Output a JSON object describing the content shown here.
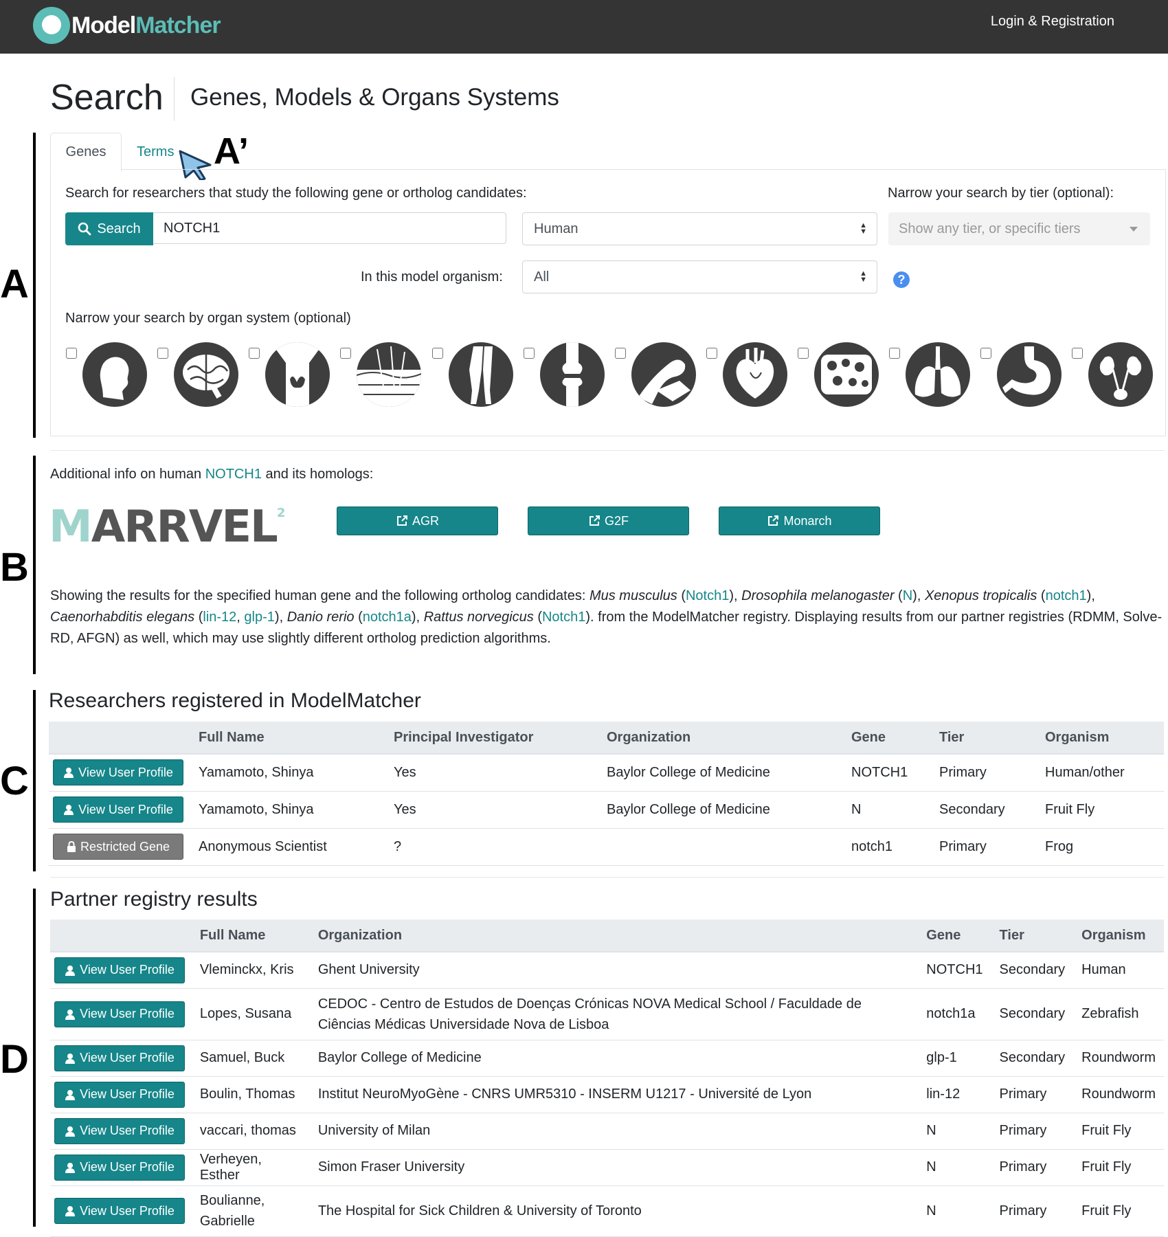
{
  "navbar": {
    "logo_a": "Model",
    "logo_b": "Matcher",
    "login": "Login & Registration"
  },
  "header": {
    "title": "Search",
    "subtitle": "Genes, Models & Organs Systems"
  },
  "section_labels": {
    "a": "A",
    "a_prime": "A’",
    "b": "B",
    "c": "C",
    "d": "D"
  },
  "tabs": {
    "genes": "Genes",
    "terms": "Terms"
  },
  "search": {
    "prompt": "Search for researchers that study the following gene or ortholog candidates:",
    "tier_prompt": "Narrow your search by tier (optional):",
    "button": "Search",
    "gene_value": "NOTCH1",
    "species_value": "Human",
    "tier_placeholder": "Show any tier, or specific tiers",
    "organism_label": "In this model organism:",
    "organism_value": "All",
    "help": "?",
    "organ_prompt": "Narrow your search by organ system (optional)"
  },
  "organs": [
    "head-neck",
    "brain",
    "thyroid",
    "skin",
    "limbs",
    "joint",
    "muscle",
    "heart",
    "blood",
    "lungs",
    "stomach",
    "kidney"
  ],
  "info": {
    "prefix": "Additional info on human ",
    "gene": "NOTCH1",
    "suffix": " and its homologs:"
  },
  "marrvel": {
    "m": "M",
    "rest": "ARRVEL",
    "sup": "2"
  },
  "external_links": [
    "AGR",
    "G2F",
    "Monarch"
  ],
  "results_text": {
    "p1": "Showing the results for the specified human gene and the following ortholog candidates: ",
    "sp1": "Mus musculus",
    "g1": "Notch1",
    "sp2": "Drosophila melanogaster",
    "g2": "N",
    "sp3": "Xenopus tropicalis",
    "g3": "notch1",
    "sp4": "Caenorhabditis elegans",
    "g4a": "lin-12",
    "g4b": "glp-1",
    "sp5": "Danio rerio",
    "g5": "notch1a",
    "sp6": "Rattus norvegicus",
    "g6": "Notch1",
    "tail": ". from the ModelMatcher registry. Displaying results from our partner registries (RDMM, Solve-RD, AFGN) as well, which may use slightly different ortholog prediction algorithms."
  },
  "registered": {
    "heading": "Researchers registered in ModelMatcher",
    "columns": [
      "Full Name",
      "Principal Investigator",
      "Organization",
      "Gene",
      "Tier",
      "Organism"
    ],
    "rows": [
      {
        "button": "View User Profile",
        "name": "Yamamoto, Shinya",
        "pi": "Yes",
        "org": "Baylor College of Medicine",
        "gene": "NOTCH1",
        "tier": "Primary",
        "organism": "Human/other"
      },
      {
        "button": "View User Profile",
        "name": "Yamamoto, Shinya",
        "pi": "Yes",
        "org": "Baylor College of Medicine",
        "gene": "N",
        "tier": "Secondary",
        "organism": "Fruit Fly"
      },
      {
        "button": "Restricted Gene",
        "name": "Anonymous Scientist",
        "pi": "?",
        "org": "",
        "gene": "notch1",
        "tier": "Primary",
        "organism": "Frog"
      }
    ]
  },
  "partner": {
    "heading": "Partner registry results",
    "columns": [
      "Full Name",
      "Organization",
      "Gene",
      "Tier",
      "Organism"
    ],
    "rows": [
      {
        "button": "View User Profile",
        "name": "Vleminckx, Kris",
        "org": "Ghent University",
        "gene": "NOTCH1",
        "tier": "Secondary",
        "organism": "Human"
      },
      {
        "button": "View User Profile",
        "name": "Lopes, Susana",
        "org": "CEDOC - Centro de Estudos de Doenças Crónicas NOVA Medical School / Faculdade de Ciências Médicas Universidade Nova de Lisboa",
        "gene": "notch1a",
        "tier": "Secondary",
        "organism": "Zebrafish"
      },
      {
        "button": "View User Profile",
        "name": "Samuel, Buck",
        "org": "Baylor College of Medicine",
        "gene": "glp-1",
        "tier": "Secondary",
        "organism": "Roundworm"
      },
      {
        "button": "View User Profile",
        "name": "Boulin, Thomas",
        "org": "Institut NeuroMyoGène - CNRS UMR5310 - INSERM U1217 - Université de Lyon",
        "gene": "lin-12",
        "tier": "Primary",
        "organism": "Roundworm"
      },
      {
        "button": "View User Profile",
        "name": "vaccari, thomas",
        "org": "University of Milan",
        "gene": "N",
        "tier": "Primary",
        "organism": "Fruit Fly"
      },
      {
        "button": "View User Profile",
        "name": "Verheyen, Esther",
        "org": "Simon Fraser University",
        "gene": "N",
        "tier": "Primary",
        "organism": "Fruit Fly"
      },
      {
        "button": "View User Profile",
        "name": "Boulianne, Gabrielle",
        "org": "The Hospital for Sick Children & University of Toronto",
        "gene": "N",
        "tier": "Primary",
        "organism": "Fruit Fly"
      }
    ]
  },
  "colors": {
    "accent": "#16868a",
    "navbar": "#343434",
    "logo": "#5bbdb6",
    "restricted": "#7a7a7a"
  }
}
